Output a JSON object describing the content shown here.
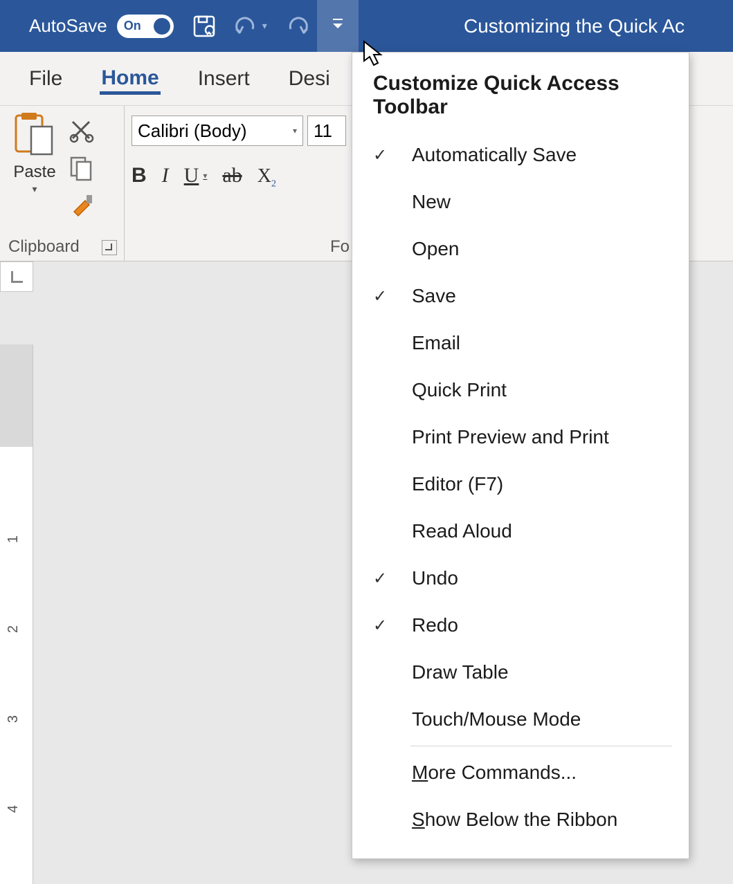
{
  "titlebar": {
    "autosave_label": "AutoSave",
    "toggle_state": "On",
    "document_title": "Customizing the Quick Ac"
  },
  "tabs": {
    "file": "File",
    "home": "Home",
    "insert": "Insert",
    "design": "Desi"
  },
  "ribbon": {
    "clipboard": {
      "paste": "Paste",
      "group_label": "Clipboard"
    },
    "font": {
      "font_name": "Calibri (Body)",
      "font_size": "11",
      "bold": "B",
      "italic": "I",
      "underline": "U",
      "strike": "ab",
      "subscript": "X",
      "subscript_sub": "2",
      "group_label": "Fo"
    }
  },
  "dropdown": {
    "title": "Customize Quick Access Toolbar",
    "items": [
      {
        "label": "Automatically Save",
        "checked": true
      },
      {
        "label": "New",
        "checked": false
      },
      {
        "label": "Open",
        "checked": false
      },
      {
        "label": "Save",
        "checked": true
      },
      {
        "label": "Email",
        "checked": false
      },
      {
        "label": "Quick Print",
        "checked": false
      },
      {
        "label": "Print Preview and Print",
        "checked": false
      },
      {
        "label": "Editor (F7)",
        "checked": false
      },
      {
        "label": "Read Aloud",
        "checked": false
      },
      {
        "label": "Undo",
        "checked": true
      },
      {
        "label": "Redo",
        "checked": true
      },
      {
        "label": "Draw Table",
        "checked": false
      },
      {
        "label": "Touch/Mouse Mode",
        "checked": false
      }
    ],
    "more_commands_pre": "M",
    "more_commands_post": "ore Commands...",
    "show_below_pre": "S",
    "show_below_post": "how Below the Ribbon"
  },
  "ruler": {
    "n1": "1",
    "n2": "2",
    "n3": "3",
    "n4": "4"
  }
}
